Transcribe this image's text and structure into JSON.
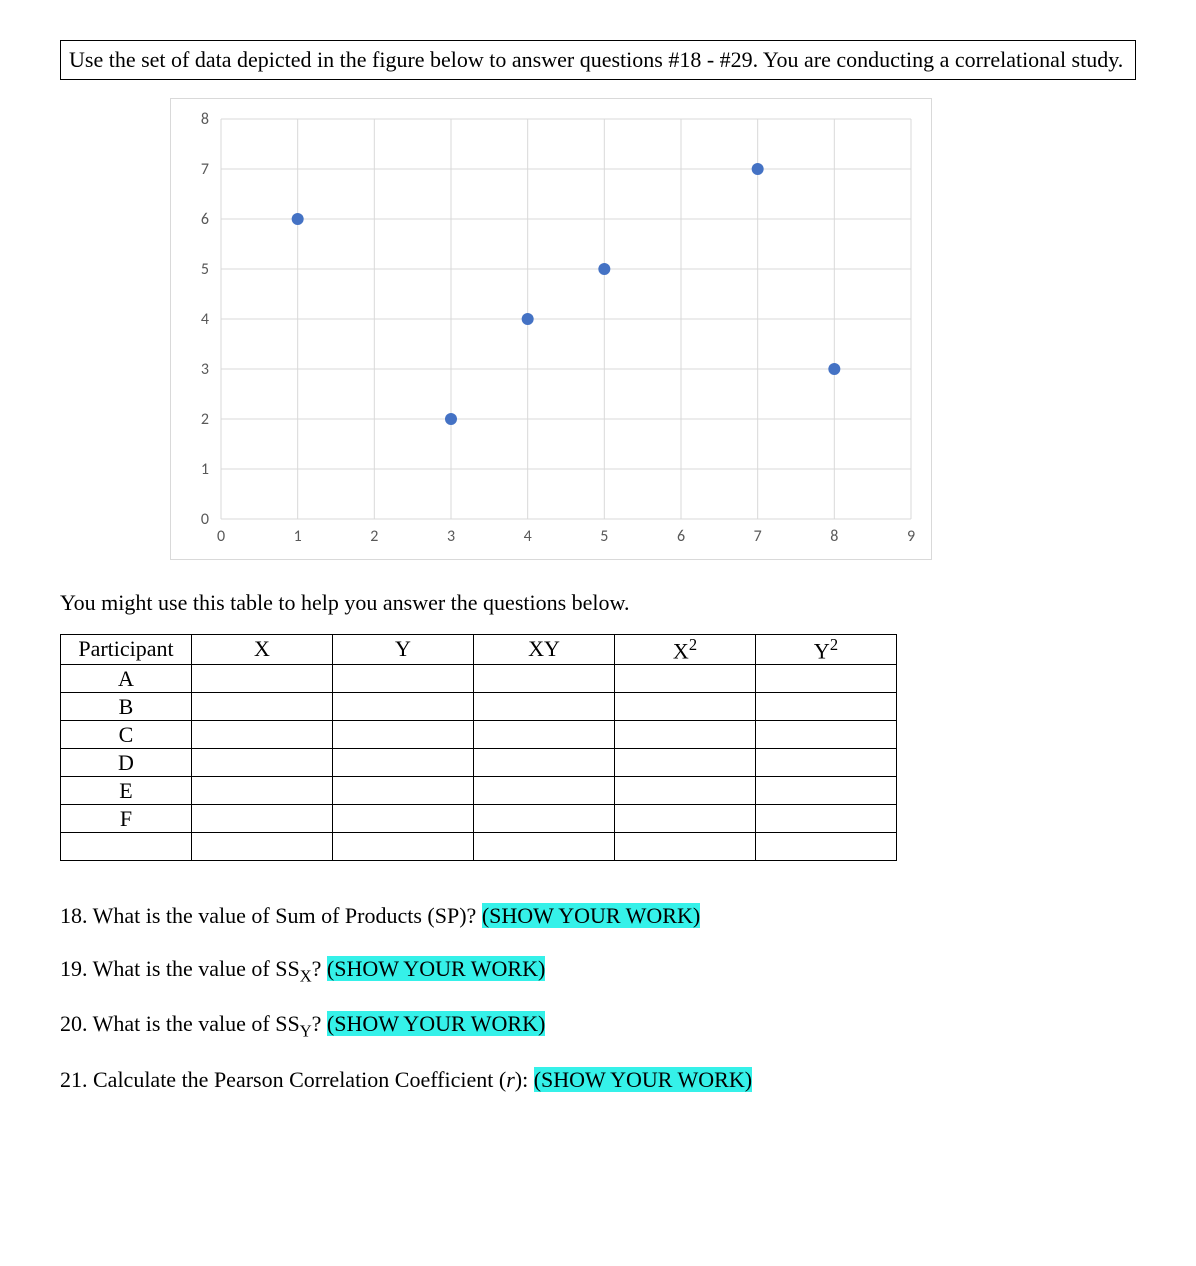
{
  "instruction": "Use the set of data depicted in the figure below to answer questions #18 - #29. You are conducting a correlational study.",
  "chart_data": {
    "type": "scatter",
    "title": "",
    "xlabel": "",
    "ylabel": "",
    "xlim": [
      0,
      9
    ],
    "ylim": [
      0,
      8
    ],
    "xticks": [
      0,
      1,
      2,
      3,
      4,
      5,
      6,
      7,
      8,
      9
    ],
    "yticks": [
      0,
      1,
      2,
      3,
      4,
      5,
      6,
      7,
      8
    ],
    "grid": true,
    "points": [
      {
        "x": 1,
        "y": 6
      },
      {
        "x": 3,
        "y": 2
      },
      {
        "x": 4,
        "y": 4
      },
      {
        "x": 5,
        "y": 5
      },
      {
        "x": 7,
        "y": 7
      },
      {
        "x": 8,
        "y": 3
      }
    ]
  },
  "helper_text": "You might use this table to help you answer the questions below.",
  "table": {
    "headers": {
      "participant": "Participant",
      "x": "X",
      "y": "Y",
      "xy": "XY",
      "x2_base": "X",
      "x2_exp": "2",
      "y2_base": "Y",
      "y2_exp": "2"
    },
    "rows": [
      "A",
      "B",
      "C",
      "D",
      "E",
      "F"
    ]
  },
  "questions": {
    "q18_pre": "18. What is the value of Sum of Products (SP)? ",
    "q18_hl": "(SHOW YOUR WORK)",
    "q19_pre": "19. What is the value of SS",
    "q19_sub": "X",
    "q19_post": "? ",
    "q19_hl": "(SHOW YOUR WORK)",
    "q20_pre": "20. What is the value of SS",
    "q20_sub": "Y",
    "q20_post": "? ",
    "q20_hl": "(SHOW YOUR WORK)",
    "q21_pre": "21. Calculate the Pearson Correlation Coefficient (",
    "q21_ital": "r",
    "q21_post": "): ",
    "q21_hl": "(SHOW YOUR WORK)"
  }
}
